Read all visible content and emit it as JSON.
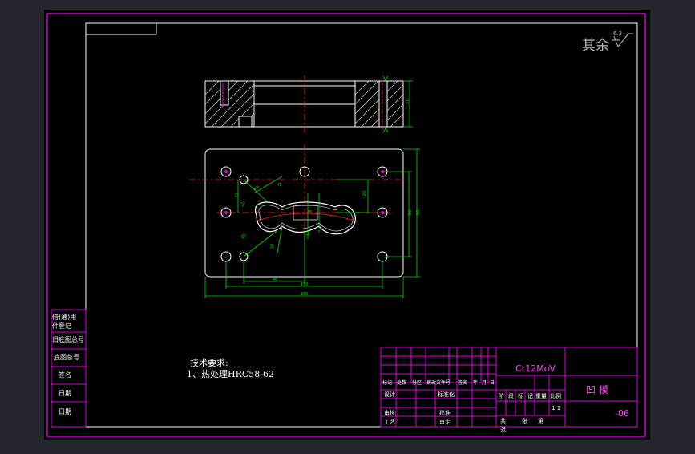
{
  "colors": {
    "frame": "#e000e0",
    "line": "#ffffff",
    "center": "#ff2222",
    "dim": "#00e000",
    "text": "#ffffff",
    "material": "#ff44ff",
    "viewport_bg": "#000000",
    "app_bg": "#23272d"
  },
  "roughness": {
    "label": "其余",
    "value": "6.3"
  },
  "tech_req": {
    "title": "技术要求:",
    "item1": "1、热处理HRC58-62"
  },
  "left_column": [
    "借(通)用",
    "件登记",
    "旧底图总号",
    "底图总号",
    "签名",
    "日期",
    "日期"
  ],
  "title_block": {
    "material": "Cr12MoV",
    "part_name": "凹  模",
    "drawing_no": "-06",
    "row_headers": [
      "标记",
      "处数",
      "分区",
      "更改文件号",
      "签名",
      "年",
      "月",
      "日"
    ],
    "labels_left": [
      "设计",
      "审核",
      "工艺"
    ],
    "labels_mid": [
      "标准化",
      "批准",
      "审定"
    ],
    "stage_headers": [
      "阶",
      "段",
      "标",
      "记",
      "重量",
      "比例"
    ],
    "scale": "1:1",
    "sheets": [
      "共",
      "张",
      "第",
      "张"
    ]
  },
  "dims": {
    "top_view_height": "31",
    "plate_width_total": "180",
    "plate_width_inner": "150",
    "plate_height_total": "90",
    "plate_height_inner": "90",
    "hole_spacing": "40",
    "small_dims": [
      "20",
      "15",
      "10",
      "R9",
      "R5",
      "8",
      "16",
      "20",
      "10"
    ]
  }
}
